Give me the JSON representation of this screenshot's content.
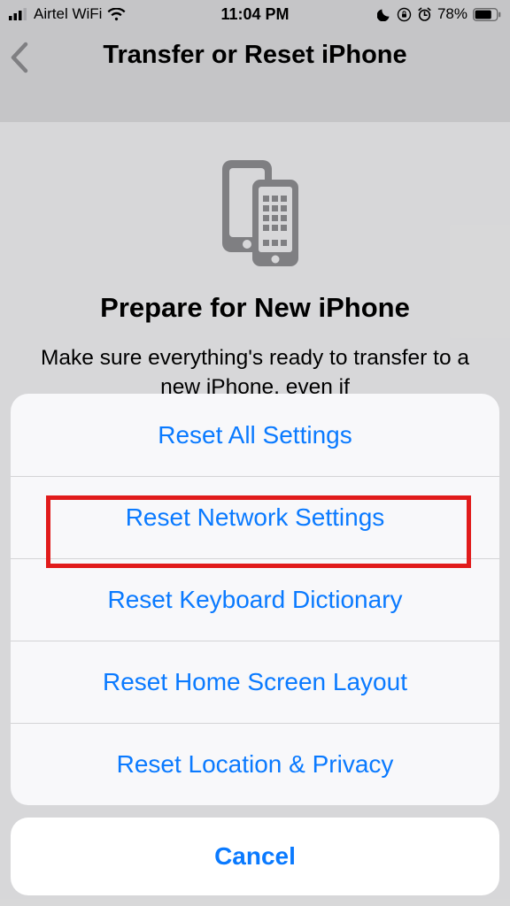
{
  "statusbar": {
    "carrier": "Airtel WiFi",
    "time": "11:04 PM",
    "battery_pct": "78%"
  },
  "nav": {
    "title": "Transfer or Reset iPhone"
  },
  "hero": {
    "heading": "Prepare for New iPhone",
    "body": "Make sure everything's ready to transfer to a new iPhone, even if"
  },
  "sheet": {
    "items": [
      "Reset All Settings",
      "Reset Network Settings",
      "Reset Keyboard Dictionary",
      "Reset Home Screen Layout",
      "Reset Location & Privacy"
    ],
    "cancel": "Cancel",
    "highlight_index": 1
  }
}
